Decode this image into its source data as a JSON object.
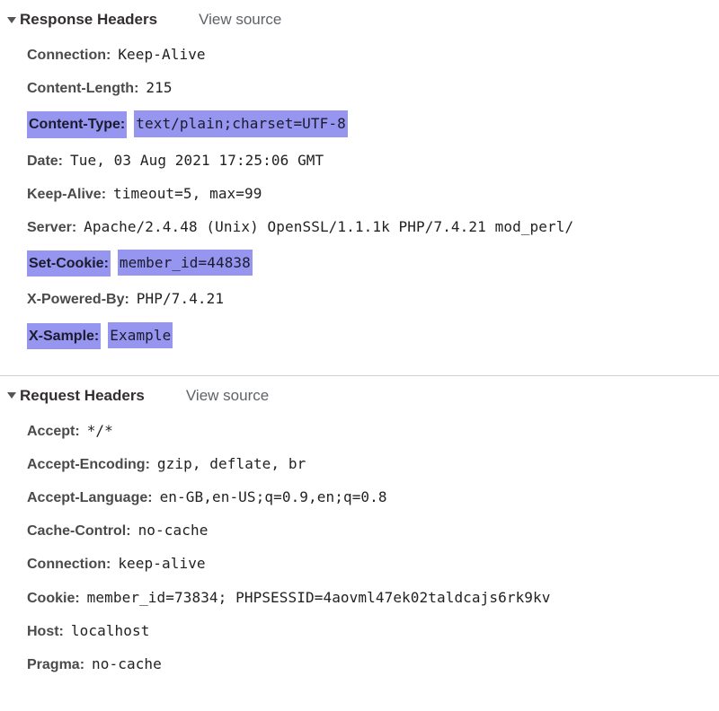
{
  "responseSection": {
    "title": "Response Headers",
    "viewSource": "View source"
  },
  "responseHeaders": [
    {
      "name": "Connection:",
      "value": "Keep-Alive",
      "highlighted": false
    },
    {
      "name": "Content-Length:",
      "value": "215",
      "highlighted": false
    },
    {
      "name": "Content-Type:",
      "value": "text/plain;charset=UTF-8",
      "highlighted": true
    },
    {
      "name": "Date:",
      "value": "Tue, 03 Aug 2021 17:25:06 GMT",
      "highlighted": false
    },
    {
      "name": "Keep-Alive:",
      "value": "timeout=5, max=99",
      "highlighted": false
    },
    {
      "name": "Server:",
      "value": "Apache/2.4.48 (Unix) OpenSSL/1.1.1k PHP/7.4.21 mod_perl/",
      "highlighted": false
    },
    {
      "name": "Set-Cookie:",
      "value": "member_id=44838",
      "highlighted": true
    },
    {
      "name": "X-Powered-By:",
      "value": "PHP/7.4.21",
      "highlighted": false
    },
    {
      "name": "X-Sample:",
      "value": "Example",
      "highlighted": true
    }
  ],
  "requestSection": {
    "title": "Request Headers",
    "viewSource": "View source"
  },
  "requestHeaders": [
    {
      "name": "Accept:",
      "value": "*/*",
      "highlighted": false
    },
    {
      "name": "Accept-Encoding:",
      "value": "gzip, deflate, br",
      "highlighted": false
    },
    {
      "name": "Accept-Language:",
      "value": "en-GB,en-US;q=0.9,en;q=0.8",
      "highlighted": false
    },
    {
      "name": "Cache-Control:",
      "value": "no-cache",
      "highlighted": false
    },
    {
      "name": "Connection:",
      "value": "keep-alive",
      "highlighted": false
    },
    {
      "name": "Cookie:",
      "value": "member_id=73834; PHPSESSID=4aovml47ek02taldcajs6rk9kv",
      "highlighted": false
    },
    {
      "name": "Host:",
      "value": "localhost",
      "highlighted": false
    },
    {
      "name": "Pragma:",
      "value": "no-cache",
      "highlighted": false
    }
  ]
}
